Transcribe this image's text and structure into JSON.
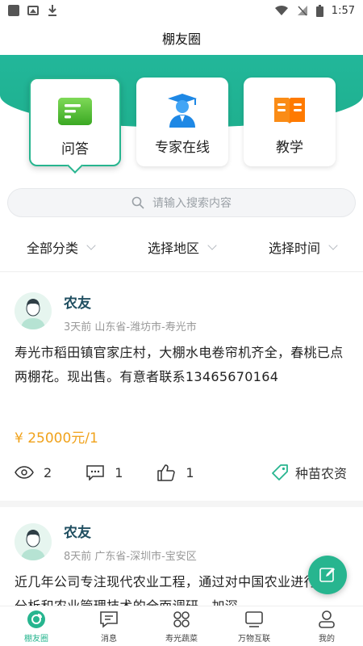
{
  "status_bar": {
    "time": "1:57"
  },
  "header": {
    "title": "棚友圈"
  },
  "cards": [
    {
      "label": "问答",
      "icon": "qa-list-icon",
      "active": true
    },
    {
      "label": "专家在线",
      "icon": "expert-icon",
      "active": false
    },
    {
      "label": "教学",
      "icon": "book-icon",
      "active": false
    }
  ],
  "search": {
    "placeholder": "请输入搜索内容"
  },
  "filters": [
    {
      "label": "全部分类"
    },
    {
      "label": "选择地区"
    },
    {
      "label": "选择时间"
    }
  ],
  "posts": [
    {
      "name": "农友",
      "time": "3天前",
      "location": "山东省-潍坊市-寿光市",
      "text": "寿光市稻田镇官家庄村，大棚水电卷帘机齐全，春桃已点两棚花。现出售。有意者联系13465670164",
      "price": "¥ 25000元/1",
      "views": "2",
      "comments": "1",
      "likes": "1",
      "tag": "种苗农资"
    },
    {
      "name": "农友",
      "time": "8天前",
      "location": "广东省-深圳市-宝安区",
      "text": "近几年公司专注现代农业工程，通过对中国农业进行深入分析和农业管理技术的全面调研，加深"
    }
  ],
  "tabbar": [
    {
      "label": "棚友圈",
      "icon": "circle-home-icon",
      "active": true
    },
    {
      "label": "消息",
      "icon": "message-icon",
      "active": false
    },
    {
      "label": "寿光蔬菜",
      "icon": "grid-icon",
      "active": false
    },
    {
      "label": "万物互联",
      "icon": "monitor-icon",
      "active": false
    },
    {
      "label": "我的",
      "icon": "user-icon",
      "active": false
    }
  ],
  "colors": {
    "accent": "#27b58f",
    "price": "#f0a21b",
    "name": "#1f4e60"
  }
}
